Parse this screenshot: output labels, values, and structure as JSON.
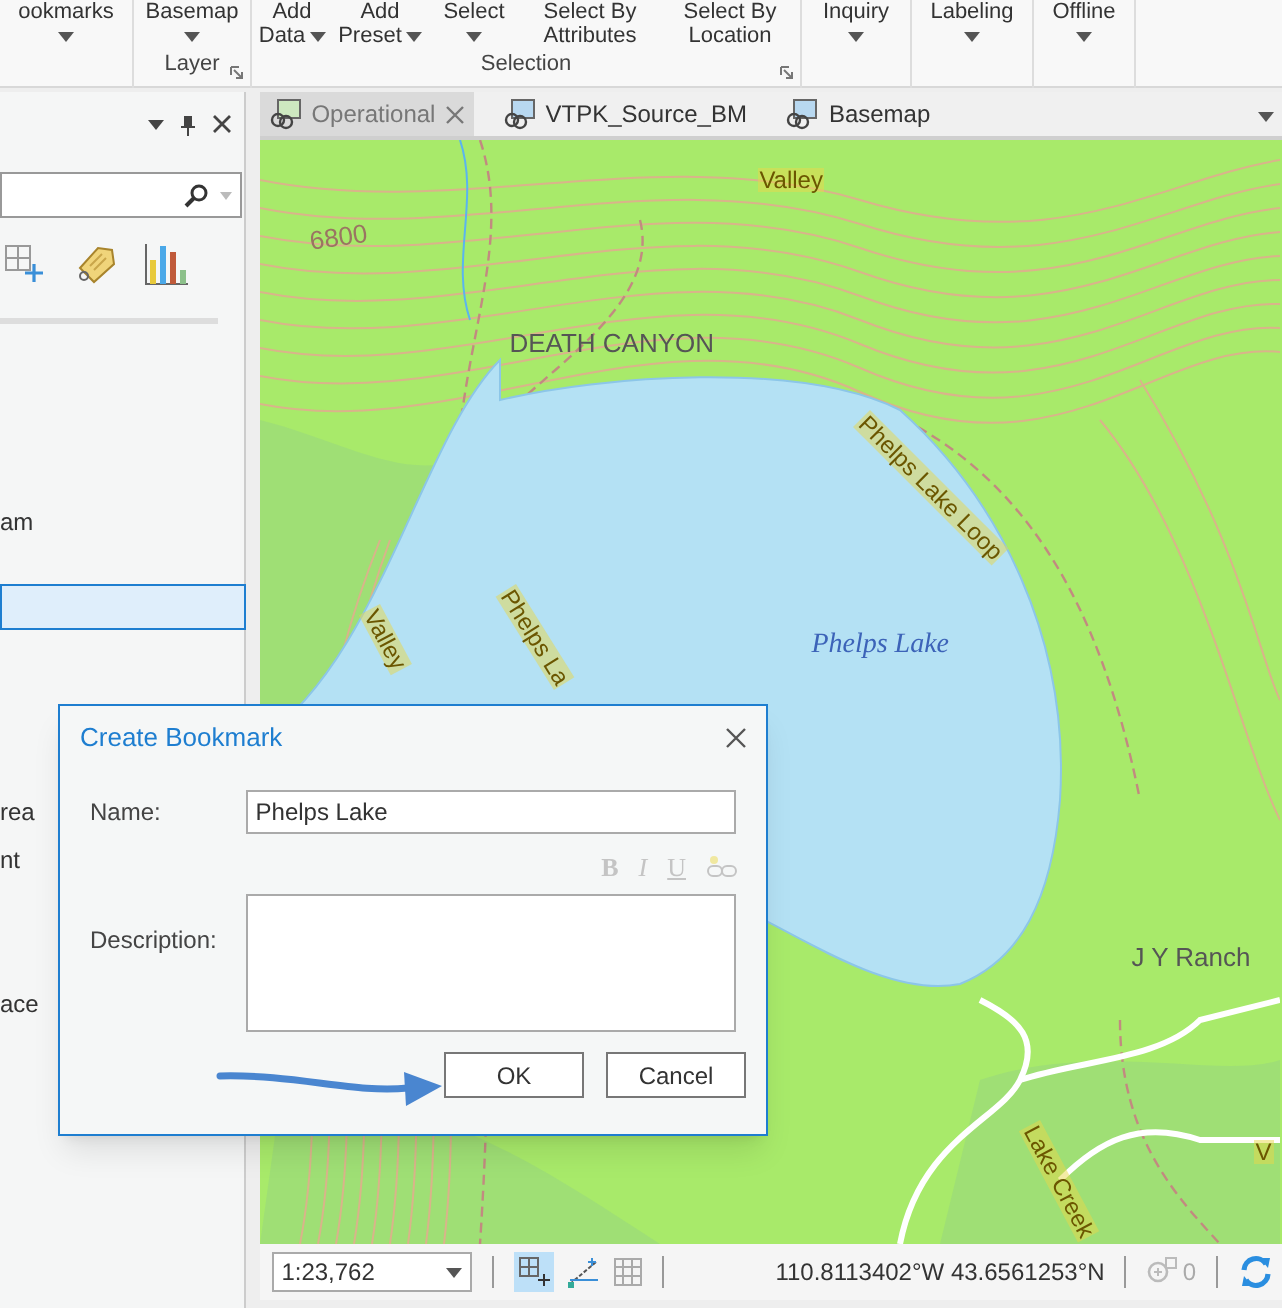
{
  "ribbon": {
    "buttons": [
      {
        "line1": "ookmarks",
        "dropdown": true
      },
      {
        "line1": "Basemap",
        "dropdown": true
      },
      {
        "line1": "Add",
        "line2": "Data",
        "dropdown": true
      },
      {
        "line1": "Add",
        "line2": "Preset",
        "dropdown": true
      },
      {
        "line1": "Select",
        "dropdown": true
      },
      {
        "line1": "Select By",
        "line2": "Attributes",
        "dropdown": false
      },
      {
        "line1": "Select By",
        "line2": "Location",
        "dropdown": false
      },
      {
        "line1": "Inquiry",
        "dropdown": true
      },
      {
        "line1": "Labeling",
        "dropdown": true
      },
      {
        "line1": "Offline",
        "dropdown": true
      }
    ],
    "groups": [
      "Layer",
      "Selection"
    ]
  },
  "pane": {
    "items": [
      {
        "text": "am",
        "selected": false
      },
      {
        "selected": true
      },
      {
        "text": "rea",
        "selected": false
      },
      {
        "text": "nt",
        "selected": false
      },
      {
        "text": "ace",
        "selected": false
      }
    ]
  },
  "tabs": [
    {
      "label": "Operational",
      "selected": true
    },
    {
      "label": "VTPK_Source_BM",
      "selected": false
    },
    {
      "label": "Basemap",
      "selected": false
    }
  ],
  "map": {
    "labels": [
      {
        "text": "Valley",
        "kind": "trail"
      },
      {
        "text": "6800",
        "kind": "contour"
      },
      {
        "text": "DEATH CANYON",
        "kind": "place"
      },
      {
        "text": "Phelps Lake Loop",
        "kind": "trail"
      },
      {
        "text": "Phelps Lake",
        "kind": "water"
      },
      {
        "text": "Valley",
        "kind": "trail"
      },
      {
        "text": "Phelps La",
        "kind": "trail"
      },
      {
        "text": "J Y Ranch",
        "kind": "place"
      },
      {
        "text": "Lake Creek",
        "kind": "trail"
      },
      {
        "text": "V",
        "kind": "trail"
      }
    ]
  },
  "status_bar": {
    "scale": "1:23,762",
    "coordinates": "110.8113402°W 43.6561253°N",
    "selection_count": "0"
  },
  "dialog": {
    "title": "Create Bookmark",
    "name_label": "Name:",
    "name_value": "Phelps Lake",
    "format_buttons": [
      {
        "label": "B",
        "disabled": true
      },
      {
        "label": "I",
        "disabled": true
      },
      {
        "label": "U",
        "disabled": true
      }
    ],
    "description_label": "Description:",
    "buttons": [
      "OK",
      "Cancel"
    ]
  }
}
